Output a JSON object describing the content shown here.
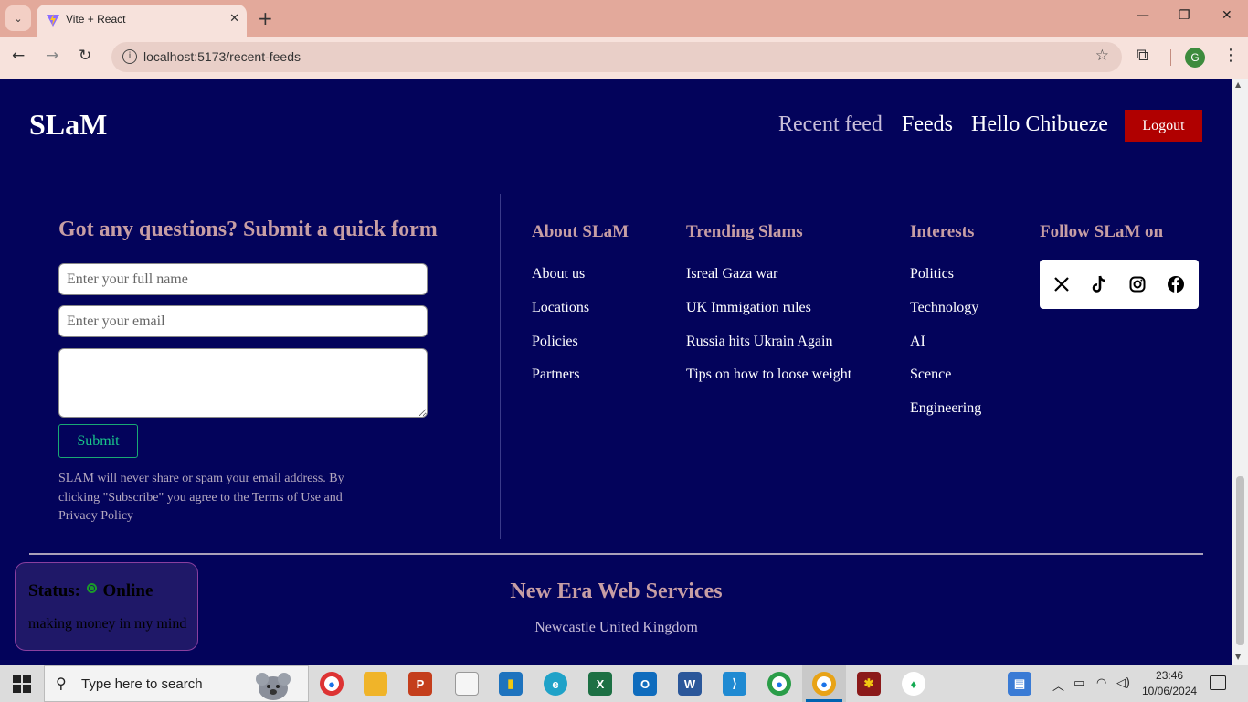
{
  "browser": {
    "tab_title": "Vite + React",
    "url": "localhost:5173/recent-feeds"
  },
  "header": {
    "brand": "SLaM",
    "nav": {
      "recent": "Recent feed",
      "feeds": "Feeds",
      "greeting": "Hello Chibueze"
    },
    "logout_label": "Logout"
  },
  "contact_form": {
    "title": "Got any questions? Submit a quick form",
    "name_placeholder": "Enter your full name",
    "email_placeholder": "Enter your email",
    "message_value": "",
    "submit_label": "Submit",
    "disclaimer": "SLAM will never share or spam your email address. By clicking \"Subscribe\" you agree to the Terms of Use and Privacy Policy"
  },
  "footer_columns": {
    "about": {
      "title": "About SLaM",
      "links": [
        "About us",
        "Locations",
        "Policies",
        "Partners"
      ]
    },
    "trending": {
      "title": "Trending Slams",
      "links": [
        "Isreal Gaza war",
        "UK Immigation rules",
        "Russia hits Ukrain Again",
        "Tips on how to loose weight"
      ]
    },
    "interests": {
      "title": "Interests",
      "links": [
        "Politics",
        "Technology",
        "AI",
        "Scence",
        "Engineering"
      ]
    },
    "follow": {
      "title": "Follow SLaM on",
      "icons": [
        "x-icon",
        "tiktok-icon",
        "instagram-icon",
        "facebook-icon"
      ]
    }
  },
  "footer_bottom": {
    "company": "New Era Web Services",
    "location": "Newcastle United Kingdom"
  },
  "status_card": {
    "label": "Status:",
    "state": "Online",
    "message": "making money in my mind",
    "indicator_color": "#1a9a2a"
  },
  "taskbar": {
    "search_placeholder": "Type here to search",
    "time": "23:46",
    "date": "10/06/2024"
  },
  "colors": {
    "page_bg": "#03035b",
    "accent_heading": "#c79ea4",
    "logout_bg": "#b00000",
    "submit_border": "#19a974"
  }
}
